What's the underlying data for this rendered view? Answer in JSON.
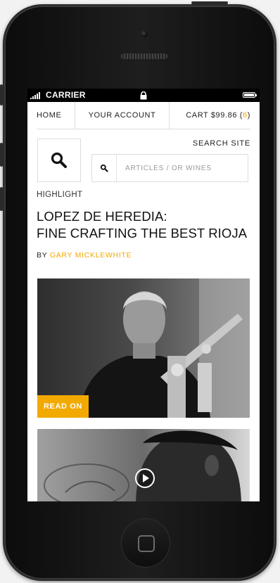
{
  "status_bar": {
    "carrier": "CARRIER"
  },
  "nav": {
    "home": "HOME",
    "account": "YOUR ACCOUNT",
    "cart_label": "CART $99.86 (",
    "cart_count": "6",
    "cart_suffix": ")"
  },
  "search": {
    "title": "SEARCH SITE",
    "placeholder": "ARTICLES / OR WINES"
  },
  "section_label": "HIGHLIGHT",
  "article": {
    "title_line1": "LOPEZ DE HEREDIA:",
    "title_line2": "FINE CRAFTING THE BEST RIOJA",
    "by": "BY",
    "author": "GARY MICKLEWHITE",
    "read_on": "READ ON"
  },
  "colors": {
    "accent": "#f2a900"
  },
  "icons": {
    "search": "search-icon",
    "play": "play-icon",
    "lock": "lock-icon",
    "battery": "battery-icon"
  }
}
